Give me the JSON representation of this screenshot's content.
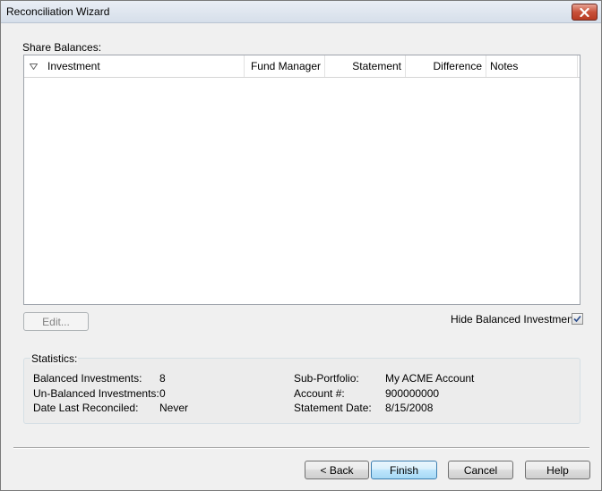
{
  "window": {
    "title": "Reconciliation Wizard"
  },
  "share_balances": {
    "label": "Share Balances:",
    "columns": [
      "Investment",
      "Fund Manager",
      "Statement",
      "Difference",
      "Notes"
    ],
    "rows": []
  },
  "edit_button": {
    "label": "Edit..."
  },
  "hide_balanced": {
    "label": "Hide Balanced Investments",
    "checked": true
  },
  "statistics": {
    "label": "Statistics:",
    "balanced_investments": {
      "label": "Balanced Investments:",
      "value": "8"
    },
    "unbalanced_investments": {
      "label": "Un-Balanced Investments:",
      "value": "0"
    },
    "date_last_reconciled": {
      "label": "Date Last Reconciled:",
      "value": "Never"
    },
    "sub_portfolio": {
      "label": "Sub-Portfolio:",
      "value": "My ACME Account"
    },
    "account_number": {
      "label": "Account #:",
      "value": "900000000"
    },
    "statement_date": {
      "label": "Statement Date:",
      "value": "8/15/2008"
    }
  },
  "footer": {
    "back_label": "< Back",
    "finish_label": "Finish",
    "cancel_label": "Cancel",
    "help_label": "Help"
  },
  "icons": {
    "close": "close-icon",
    "sort": "sort-triangle-icon",
    "check": "checkmark-icon"
  }
}
